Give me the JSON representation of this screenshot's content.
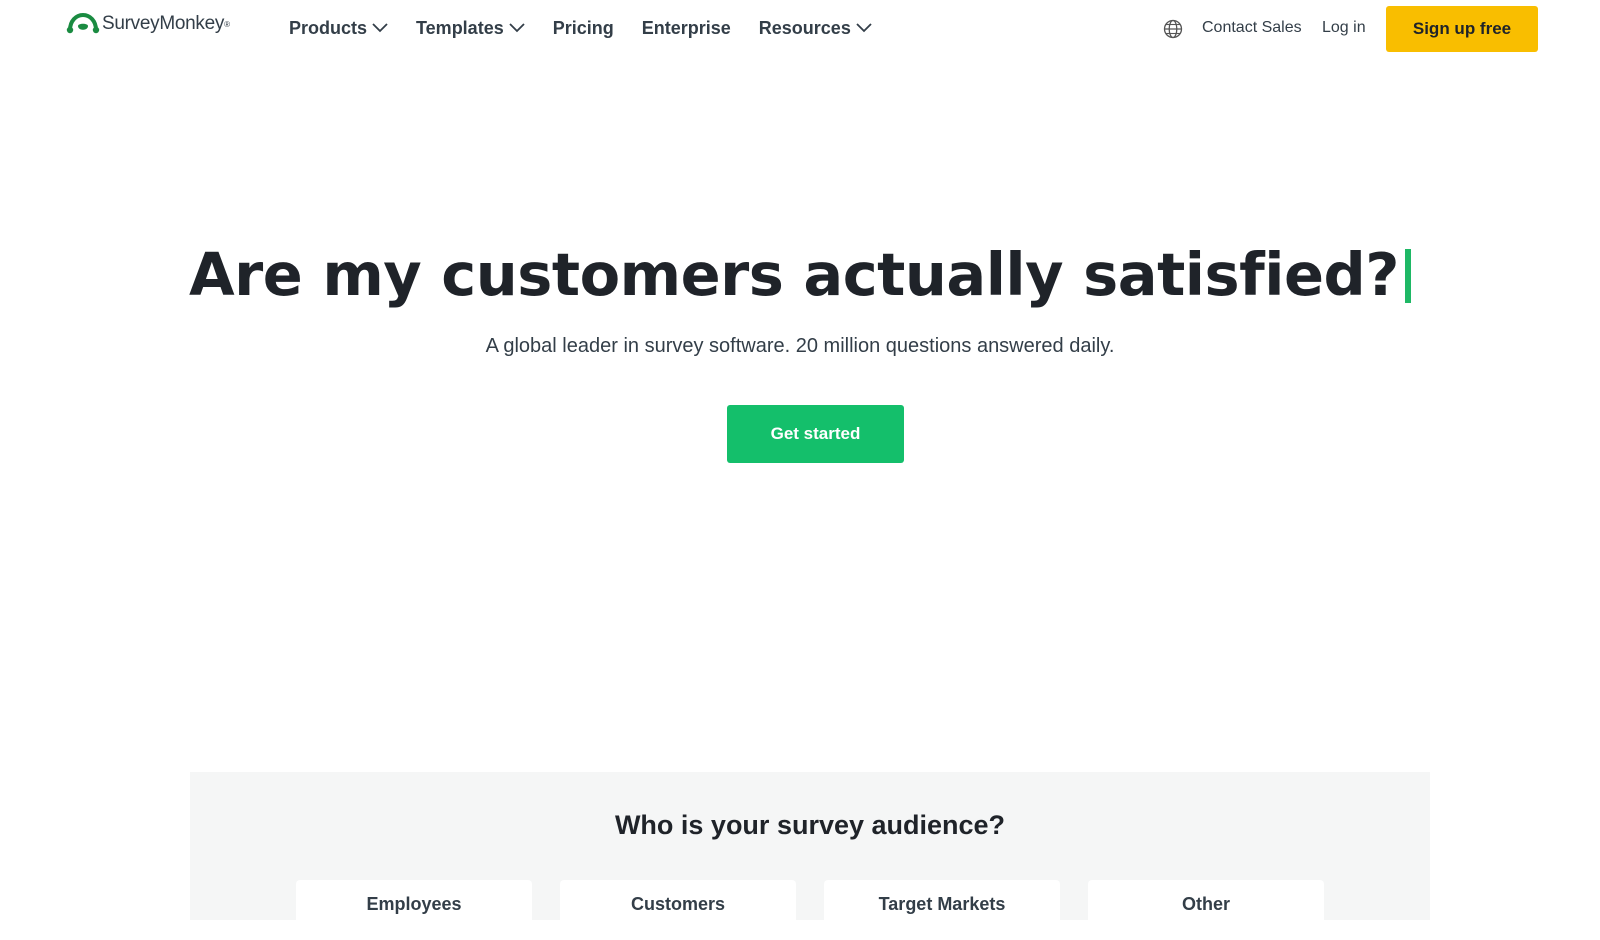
{
  "brand": {
    "name": "SurveyMonkey",
    "logo_icon": "surveymonkey-logo-icon",
    "colors": {
      "primary_green": "#14bf6b",
      "signup_yellow": "#f9be00",
      "text_dark": "#1f2329",
      "caret_green": "#1eb865",
      "audience_bg": "#f5f6f6"
    }
  },
  "header": {
    "nav": [
      {
        "label": "Products",
        "has_dropdown": true
      },
      {
        "label": "Templates",
        "has_dropdown": true
      },
      {
        "label": "Pricing",
        "has_dropdown": false
      },
      {
        "label": "Enterprise",
        "has_dropdown": false
      },
      {
        "label": "Resources",
        "has_dropdown": true
      }
    ],
    "globe_icon": "globe-icon",
    "contact_sales": "Contact Sales",
    "login": "Log in",
    "signup": "Sign up free"
  },
  "hero": {
    "title": "Are my customers actually satisfied?",
    "subtitle": "A global leader in survey software. 20 million questions answered daily.",
    "cta": "Get started"
  },
  "audience": {
    "title": "Who is your survey audience?",
    "options": [
      "Employees",
      "Customers",
      "Target Markets",
      "Other"
    ]
  }
}
